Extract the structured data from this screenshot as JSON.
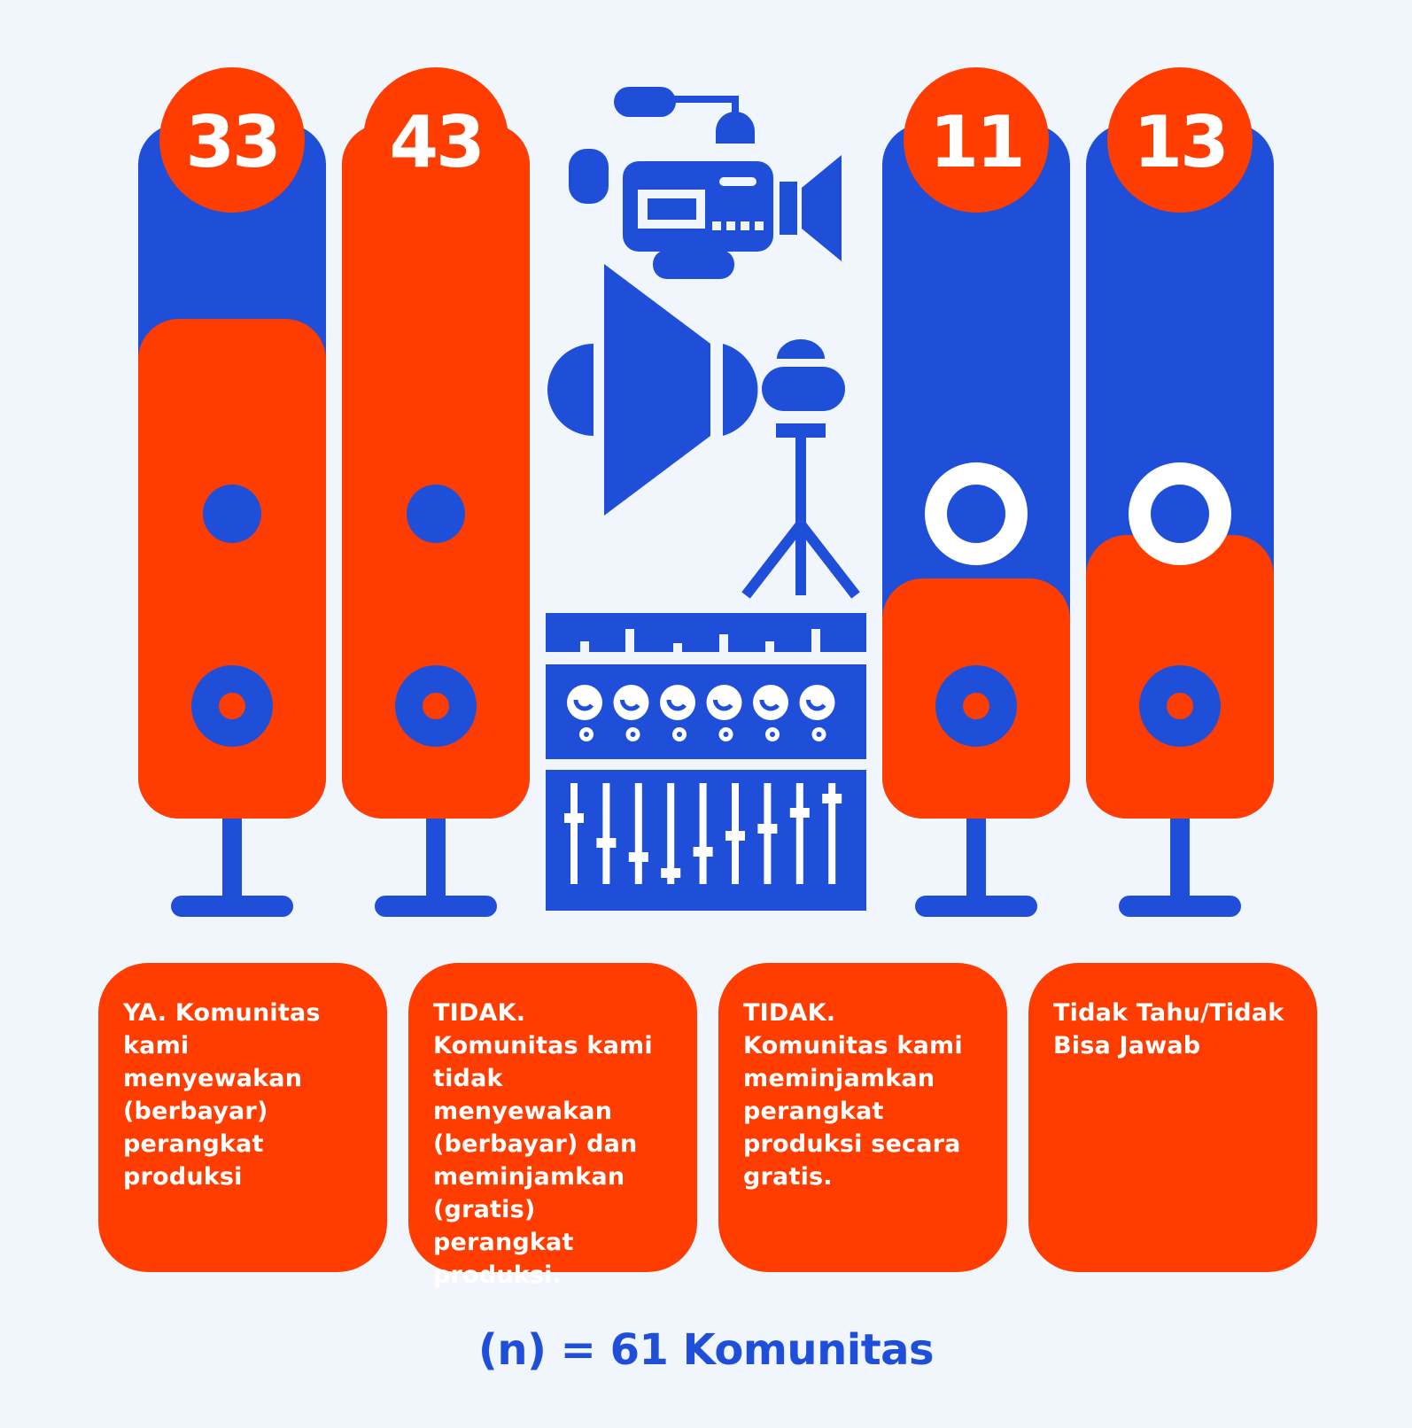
{
  "colors": {
    "background": "#F1F5FC",
    "blue": "#1F4FD8",
    "orange": "#FF3D00",
    "white": "#FFFFFF"
  },
  "chart_data": {
    "type": "bar",
    "categories": [
      "YA. Komunitas kami menyewakan (berbayar) perangkat produksi",
      "TIDAK. Komunitas kami tidak menyewakan (berbayar) dan meminjamkan (gratis) perangkat produksi.",
      "TIDAK. Komunitas kami meminjamkan perangkat produksi secara gratis.",
      "Tidak Tahu/Tidak Bisa Jawab"
    ],
    "values": [
      33,
      43,
      11,
      13
    ],
    "value_labels": [
      "33",
      "43",
      "11",
      "13"
    ],
    "total": 61,
    "encoding": "orange fill height of each speaker"
  },
  "note": "(n) = 61 Komunitas",
  "icons": [
    "speaker-icon",
    "video-camera-icon",
    "studio-light-icon",
    "audio-mixer-icon"
  ]
}
